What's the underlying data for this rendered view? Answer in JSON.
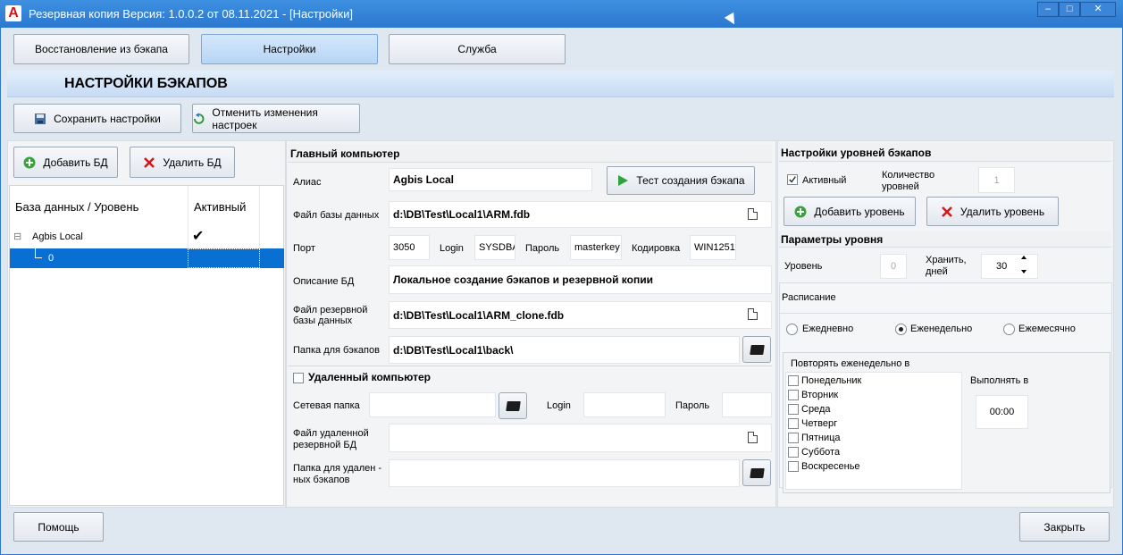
{
  "window": {
    "title": "Резервная копия   Версия: 1.0.0.2 от 08.11.2021 - [Настройки]",
    "logo": "A",
    "minimize": "–",
    "maximize": "□",
    "close": "✕"
  },
  "tabs": [
    {
      "label": "Восстановление из бэкапа"
    },
    {
      "label": "Настройки"
    },
    {
      "label": "Служба"
    }
  ],
  "page_title": "НАСТРОЙКИ БЭКАПОВ",
  "toolbar": {
    "save_label": "Сохранить настройки",
    "cancel_label": "Отменить изменения настроек"
  },
  "db_panel": {
    "add_label": "Добавить БД",
    "delete_label": "Удалить БД",
    "col_db": "База данных / Уровень",
    "col_active": "Активный",
    "rows": [
      {
        "name": "Agbis Local",
        "active": "✔",
        "expander": "⊟"
      },
      {
        "name": "0",
        "active": ""
      }
    ]
  },
  "main_computer": {
    "title": "Главный компьютер",
    "alias_label": "Алиас",
    "alias_value": "Agbis Local",
    "test_button": "Тест создания бэкапа",
    "db_file_label": "Файл базы данных",
    "db_file_value": "d:\\DB\\Test\\Local1\\ARM.fdb",
    "port_label": "Порт",
    "port_value": "3050",
    "login_label": "Login",
    "login_value": "SYSDBA",
    "password_label": "Пароль",
    "password_value": "masterkey",
    "encoding_label": "Кодировка",
    "encoding_value": "WIN1251",
    "desc_label": "Описание БД",
    "desc_value": "Локальное создание бэкапов и резервной копии",
    "backup_db_label_1": "Файл резервной",
    "backup_db_label_2": "базы данных",
    "backup_db_value": "d:\\DB\\Test\\Local1\\ARM_clone.fdb",
    "backup_folder_label": "Папка для бэкапов",
    "backup_folder_value": "d:\\DB\\Test\\Local1\\back\\"
  },
  "remote_computer": {
    "title": "Удаленный компьютер",
    "net_folder_label": "Сетевая папка",
    "net_folder_value": "",
    "login_label": "Login",
    "login_value": "",
    "password_label": "Пароль",
    "password_value": "",
    "remote_file_label_1": "Файл удаленной",
    "remote_file_label_2": "резервной БД",
    "remote_file_value": "",
    "remote_folder_label_1": "Папка для удален -",
    "remote_folder_label_2": "ных бэкапов",
    "remote_folder_value": ""
  },
  "levels": {
    "title": "Настройки уровней бэкапов",
    "active_label": "Активный",
    "count_label_1": "Количество",
    "count_label_2": "уровней",
    "count_value": "1",
    "add_label": "Добавить уровень",
    "delete_label": "Удалить уровень"
  },
  "level_params": {
    "title": "Параметры уровня",
    "level_label": "Уровень",
    "level_value": "0",
    "keep_label_1": "Хранить,",
    "keep_label_2": "дней",
    "keep_value": "30",
    "schedule_label": "Расписание",
    "daily": "Ежедневно",
    "weekly": "Еженедельно",
    "monthly": "Ежемесячно",
    "repeat_label": "Повторять еженедельно в",
    "days": [
      "Понедельник",
      "Вторник",
      "Среда",
      "Четверг",
      "Пятница",
      "Суббота",
      "Воскресенье"
    ],
    "run_at_label": "Выполнять в",
    "run_at_value": "00:00"
  },
  "footer": {
    "help_label": "Помощь",
    "close_label": "Закрыть"
  },
  "colors": {
    "titlebar": "#2c78cf",
    "selection": "#0a6fd2",
    "background": "#dfe7f1"
  }
}
